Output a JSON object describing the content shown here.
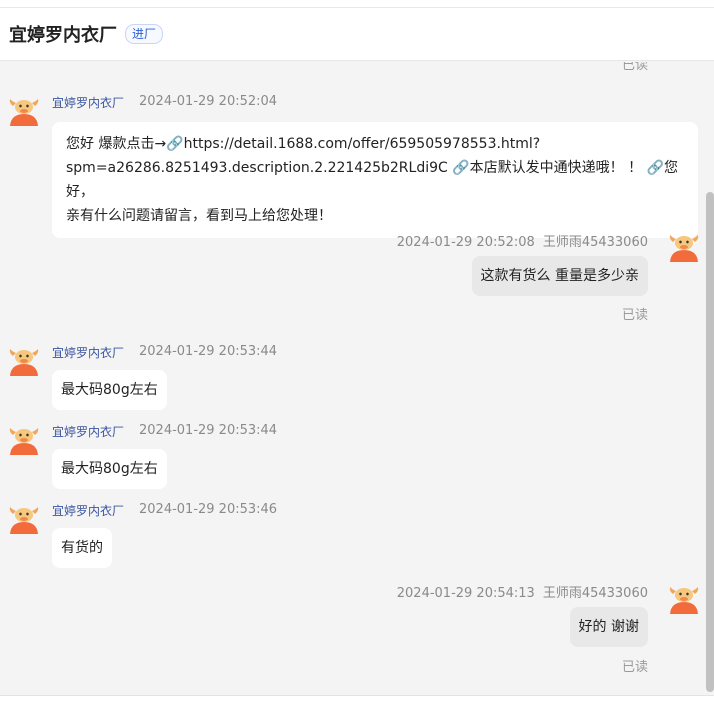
{
  "header": {
    "title": "宜婷罗内衣厂",
    "tag": "进厂"
  },
  "read_label": "已读",
  "messages": [
    {
      "side": "left",
      "sender": "宜婷罗内衣厂",
      "time": "2024-01-29 20:52:04",
      "lines": [
        "  您好  爆款点击→🔗https://detail.1688.com/offer/659505978553.html?",
        "spm=a26286.8251493.description.2.221425b2RLdi9C 🔗本店默认发中通快递哦！ ！ 🔗您好，",
        "亲有什么问题请留言，看到马上给您处理！"
      ]
    },
    {
      "side": "right",
      "sender": "王师雨45433060",
      "time": "2024-01-29 20:52:08",
      "text": "这款有货么  重量是多少亲"
    },
    {
      "side": "left",
      "sender": "宜婷罗内衣厂",
      "time": "2024-01-29 20:53:44",
      "text": "最大码80g左右"
    },
    {
      "side": "left",
      "sender": "宜婷罗内衣厂",
      "time": "2024-01-29 20:53:44",
      "text": "最大码80g左右"
    },
    {
      "side": "left",
      "sender": "宜婷罗内衣厂",
      "time": "2024-01-29 20:53:46",
      "text": "有货的"
    },
    {
      "side": "right",
      "sender": "王师雨45433060",
      "time": "2024-01-29 20:54:13",
      "text": "好的 谢谢"
    }
  ]
}
